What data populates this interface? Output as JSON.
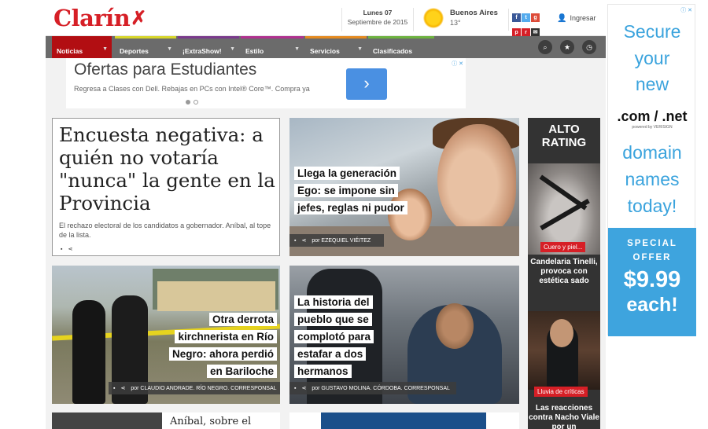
{
  "header": {
    "logo": "Clarín",
    "date_line1": "Lunes 07",
    "date_line2": "Septiembre de 2015",
    "city": "Buenos Aires",
    "temperature": "13°",
    "login_label": "Ingresar"
  },
  "nav": {
    "items": [
      {
        "label": "Noticias",
        "color": "#b20e12"
      },
      {
        "label": "Deportes",
        "color": "#d7d62a"
      },
      {
        "label": "¡ExtraShow!",
        "color": "#7a3a8c"
      },
      {
        "label": "Estilo",
        "color": "#b0318f"
      },
      {
        "label": "Servicios",
        "color": "#e58a1f"
      },
      {
        "label": "Clasificados",
        "color": "#6db33f"
      }
    ],
    "icons": [
      "search-icon",
      "star-icon",
      "clock-icon"
    ]
  },
  "ad_top": {
    "title": "Ofertas para Estudiantes",
    "subtitle": "Regresa a Clases con Dell. Rebajas en PCs con Intel® Core™. Compra ya",
    "arrow": "›",
    "adchoice": "ⓘ ✕"
  },
  "stories": {
    "lead": {
      "headline": "Encuesta negativa: a quién no votaría \"nunca\" la gente en la Provincia",
      "summary": "El rechazo electoral de los candidatos a gobernador. Aníbal, al tope de la lista."
    },
    "ego": {
      "headline": "Llega la generación Ego: se impone sin jefes, reglas ni pudor",
      "author": "por EZEQUIEL VIÉITEZ"
    },
    "rionegro": {
      "headline": "Otra derrota kirchnerista en Río Negro: ahora perdió en Bariloche",
      "author": "por CLAUDIO ANDRADE. RÍO NEGRO. CORRESPONSAL"
    },
    "pueblo": {
      "headline": "La historia del pueblo que se complotó para estafar a dos hermanos",
      "author": "por GUSTAVO MOLINA. CÓRDOBA. CORRESPONSAL"
    },
    "bottom_left": "Aníbal, sobre el"
  },
  "alto_rating": {
    "title": "ALTO RATING",
    "tag1": "Cuero y piel...",
    "caption1": "Candelaria Tinelli, provoca con estética sado",
    "tag2": "Lluvia de críticas",
    "caption2": "Las reacciones contra Nacho Viale por un"
  },
  "ad_right": {
    "line1": "Secure",
    "line2": "your",
    "line3": "new",
    "brand": ".com / .net",
    "powered": "powered by VERISIGN",
    "line4": "domain",
    "line5": "names",
    "line6": "today!",
    "offer1": "SPECIAL",
    "offer2": "OFFER",
    "price": "$9.99",
    "each": "each!",
    "adchoice": "ⓘ ✕"
  },
  "colors": {
    "brand": "#d61f26",
    "nav_bg": "#6b6b6b",
    "ad_blue": "#3ea4de"
  }
}
